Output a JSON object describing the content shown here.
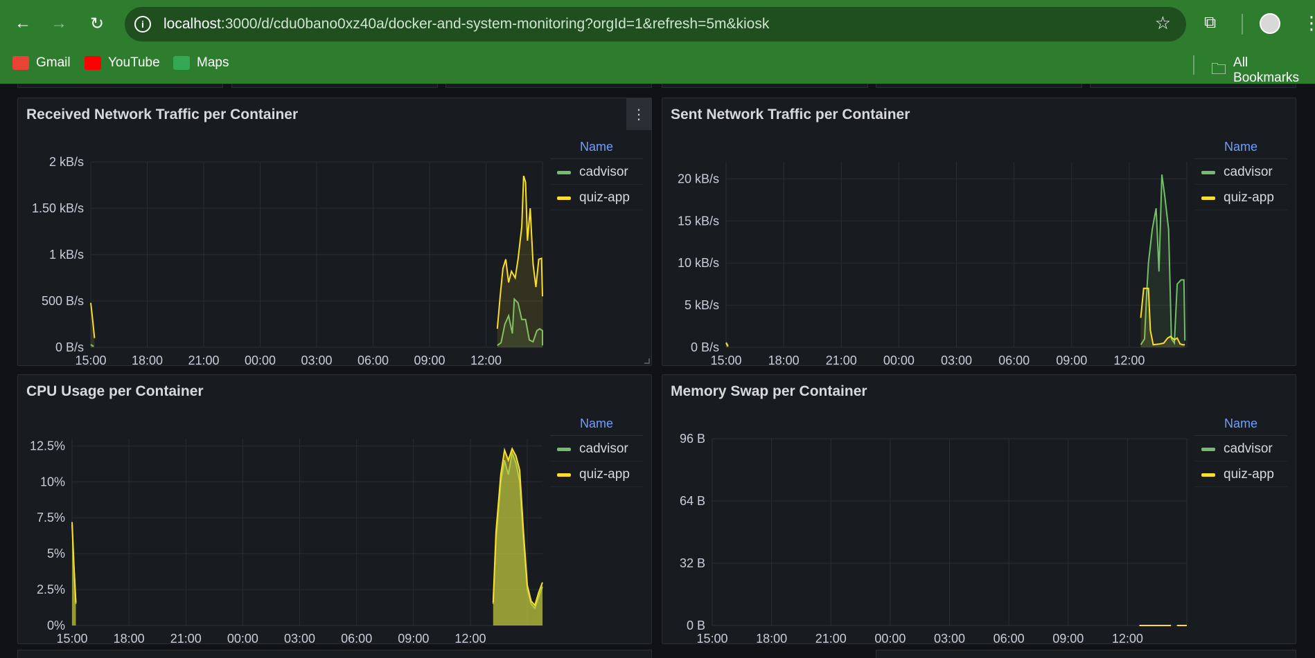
{
  "browser": {
    "url_host": "localhost",
    "url_rest": ":3000/d/cdu0bano0xz40a/docker-and-system-monitoring?orgId=1&refresh=5m&kiosk",
    "bookmarks": [
      {
        "label": "Gmail",
        "icon": "gmail-icon",
        "color": "#ea4335"
      },
      {
        "label": "YouTube",
        "icon": "youtube-icon",
        "color": "#ff0000"
      },
      {
        "label": "Maps",
        "icon": "maps-icon",
        "color": "#34a853"
      }
    ],
    "all_bookmarks": "All Bookmarks"
  },
  "legend_header": "Name",
  "series_colors": {
    "cadvisor": "#73bf69",
    "quiz-app": "#fade2a"
  },
  "panels": [
    {
      "title": "Received Network Traffic per Container",
      "legend": [
        "cadvisor",
        "quiz-app"
      ]
    },
    {
      "title": "Sent Network Traffic per Container",
      "legend": [
        "cadvisor",
        "quiz-app"
      ]
    },
    {
      "title": "CPU Usage per Container",
      "legend": [
        "cadvisor",
        "quiz-app"
      ]
    },
    {
      "title": "Memory Swap per Container",
      "legend": [
        "cadvisor",
        "quiz-app"
      ]
    }
  ],
  "chart_data": [
    {
      "type": "line",
      "title": "Received Network Traffic per Container",
      "x_ticks": [
        "15:00",
        "18:00",
        "21:00",
        "00:00",
        "03:00",
        "06:00",
        "09:00",
        "12:00"
      ],
      "y_ticks": [
        "0 B/s",
        "500 B/s",
        "1 kB/s",
        "1.50 kB/s",
        "2 kB/s"
      ],
      "ylim": [
        0,
        2000
      ],
      "xlim": [
        15,
        39.0
      ],
      "series": [
        {
          "name": "cadvisor",
          "points": [
            [
              15.0,
              30
            ],
            [
              15.15,
              10
            ],
            [
              36.6,
              20
            ],
            [
              36.8,
              50
            ],
            [
              37.0,
              250
            ],
            [
              37.2,
              340
            ],
            [
              37.4,
              150
            ],
            [
              37.5,
              520
            ],
            [
              37.7,
              480
            ],
            [
              37.9,
              300
            ],
            [
              38.1,
              300
            ],
            [
              38.3,
              80
            ],
            [
              38.5,
              60
            ],
            [
              38.7,
              180
            ],
            [
              38.85,
              200
            ],
            [
              39.0,
              180
            ],
            [
              39.0,
              20
            ]
          ]
        },
        {
          "name": "quiz-app",
          "points": [
            [
              15.0,
              480
            ],
            [
              15.1,
              300
            ],
            [
              15.2,
              100
            ],
            [
              36.6,
              200
            ],
            [
              36.75,
              550
            ],
            [
              36.9,
              850
            ],
            [
              37.05,
              950
            ],
            [
              37.2,
              700
            ],
            [
              37.35,
              820
            ],
            [
              37.55,
              750
            ],
            [
              37.7,
              950
            ],
            [
              37.9,
              1300
            ],
            [
              38.0,
              1850
            ],
            [
              38.1,
              1780
            ],
            [
              38.2,
              1150
            ],
            [
              38.35,
              1500
            ],
            [
              38.5,
              900
            ],
            [
              38.65,
              650
            ],
            [
              38.8,
              950
            ],
            [
              38.95,
              960
            ],
            [
              39.0,
              550
            ]
          ]
        }
      ]
    },
    {
      "type": "line",
      "title": "Sent Network Traffic per Container",
      "x_ticks": [
        "15:00",
        "18:00",
        "21:00",
        "00:00",
        "03:00",
        "06:00",
        "09:00",
        "12:00"
      ],
      "y_ticks": [
        "0 B/s",
        "5 kB/s",
        "10 kB/s",
        "15 kB/s",
        "20 kB/s"
      ],
      "ylim": [
        0,
        22000
      ],
      "xlim": [
        15,
        39.0
      ],
      "series": [
        {
          "name": "cadvisor",
          "points": [
            [
              15.0,
              600
            ],
            [
              15.1,
              200
            ],
            [
              36.6,
              300
            ],
            [
              36.8,
              1000
            ],
            [
              36.9,
              6000
            ],
            [
              37.0,
              10000
            ],
            [
              37.2,
              14000
            ],
            [
              37.4,
              16500
            ],
            [
              37.55,
              9000
            ],
            [
              37.7,
              20500
            ],
            [
              37.85,
              18000
            ],
            [
              38.05,
              14000
            ],
            [
              38.2,
              1000
            ],
            [
              38.35,
              500
            ],
            [
              38.5,
              7500
            ],
            [
              38.7,
              8000
            ],
            [
              38.85,
              8000
            ],
            [
              38.9,
              800
            ]
          ]
        },
        {
          "name": "quiz-app",
          "points": [
            [
              15.0,
              500
            ],
            [
              15.1,
              100
            ],
            [
              36.6,
              3500
            ],
            [
              36.75,
              7000
            ],
            [
              37.0,
              7000
            ],
            [
              37.1,
              2000
            ],
            [
              37.25,
              300
            ],
            [
              37.6,
              400
            ],
            [
              37.8,
              500
            ],
            [
              38.0,
              1100
            ],
            [
              38.15,
              1300
            ],
            [
              38.35,
              900
            ],
            [
              38.5,
              1100
            ],
            [
              38.65,
              400
            ],
            [
              38.8,
              300
            ],
            [
              38.9,
              300
            ]
          ]
        }
      ]
    },
    {
      "type": "area",
      "title": "CPU Usage per Container",
      "x_ticks": [
        "15:00",
        "18:00",
        "21:00",
        "00:00",
        "03:00",
        "06:00",
        "09:00",
        "12:00"
      ],
      "y_ticks": [
        "0%",
        "2.5%",
        "5%",
        "7.5%",
        "10%",
        "12.5%"
      ],
      "ylim": [
        0,
        13.0
      ],
      "xlim": [
        15,
        39.8
      ],
      "series": [
        {
          "name": "cadvisor",
          "points": [
            [
              15.0,
              7.0
            ],
            [
              15.1,
              4.0
            ],
            [
              15.2,
              1.5
            ],
            [
              37.2,
              1.5
            ],
            [
              37.35,
              6.0
            ],
            [
              37.6,
              10.0
            ],
            [
              37.8,
              11.5
            ],
            [
              38.0,
              10.5
            ],
            [
              38.2,
              12.0
            ],
            [
              38.4,
              11.3
            ],
            [
              38.6,
              10.0
            ],
            [
              38.8,
              6.0
            ],
            [
              39.0,
              2.5
            ],
            [
              39.2,
              1.5
            ],
            [
              39.4,
              1.2
            ],
            [
              39.6,
              2.0
            ],
            [
              39.8,
              2.7
            ]
          ]
        },
        {
          "name": "quiz-app",
          "points": [
            [
              15.0,
              7.2
            ],
            [
              15.1,
              4.2
            ],
            [
              15.2,
              1.6
            ],
            [
              37.2,
              1.6
            ],
            [
              37.35,
              6.5
            ],
            [
              37.6,
              10.5
            ],
            [
              37.8,
              12.2
            ],
            [
              38.0,
              11.5
            ],
            [
              38.2,
              12.3
            ],
            [
              38.4,
              11.8
            ],
            [
              38.6,
              10.8
            ],
            [
              38.8,
              6.5
            ],
            [
              39.0,
              2.8
            ],
            [
              39.2,
              1.7
            ],
            [
              39.4,
              1.4
            ],
            [
              39.6,
              2.3
            ],
            [
              39.8,
              3.0
            ]
          ]
        }
      ]
    },
    {
      "type": "line",
      "title": "Memory Swap per Container",
      "x_ticks": [
        "15:00",
        "18:00",
        "21:00",
        "00:00",
        "03:00",
        "06:00",
        "09:00",
        "12:00"
      ],
      "y_ticks": [
        "0 B",
        "32 B",
        "64 B",
        "96 B"
      ],
      "ylim": [
        0,
        96
      ],
      "xlim": [
        15,
        39.0
      ],
      "series": [
        {
          "name": "cadvisor",
          "points": []
        },
        {
          "name": "quiz-app",
          "points": [
            [
              36.6,
              0
            ],
            [
              38.2,
              0
            ]
          ],
          "extra": [
            [
              38.5,
              0
            ],
            [
              39.0,
              0
            ]
          ]
        }
      ]
    }
  ]
}
